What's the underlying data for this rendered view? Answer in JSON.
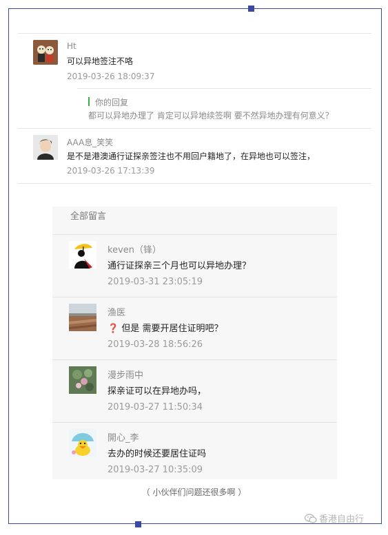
{
  "top_comments": [
    {
      "user": "Ht",
      "text": "可以异地签注不咯",
      "time": "2019-03-26 18:09:37",
      "avatar": "cartoon-characters-avatar"
    },
    {
      "user": "AAA息_笑笑",
      "text": "是不是港澳通行证探亲签注也不用回户籍地了，在异地也可以签注，",
      "time": "2019-03-26 17:13:39",
      "avatar": "person-portrait-avatar"
    }
  ],
  "reply": {
    "label": "你的回复",
    "text": "都可以异地办理了 肯定可以异地续签啊 要不然异地办理有何意义？"
  },
  "panel": {
    "title": "全部留言",
    "comments": [
      {
        "user": "keven（锋）",
        "text": "通行证探亲三个月也可以异地办理？",
        "time": "2019-03-31 23:05:19",
        "avatar": "figure-with-umbrella-avatar"
      },
      {
        "user": "渔医",
        "icon": "❓",
        "text": "但是 需要开居住证明吧？",
        "time": "2019-03-28 18:56:26",
        "avatar": "landscape-field-avatar"
      },
      {
        "user": "漫步雨中",
        "text": "探亲证可以在异地办吗，",
        "time": "2019-03-27 11:50:34",
        "avatar": "flowers-avatar"
      },
      {
        "user": "開心_李",
        "text": "去办的时候还要居住证吗",
        "time": "2019-03-27 10:35:09",
        "avatar": "yellow-duck-avatar"
      }
    ]
  },
  "caption": "（ 小伙伴们问题还很多啊 ）",
  "watermark": "香港自由行"
}
